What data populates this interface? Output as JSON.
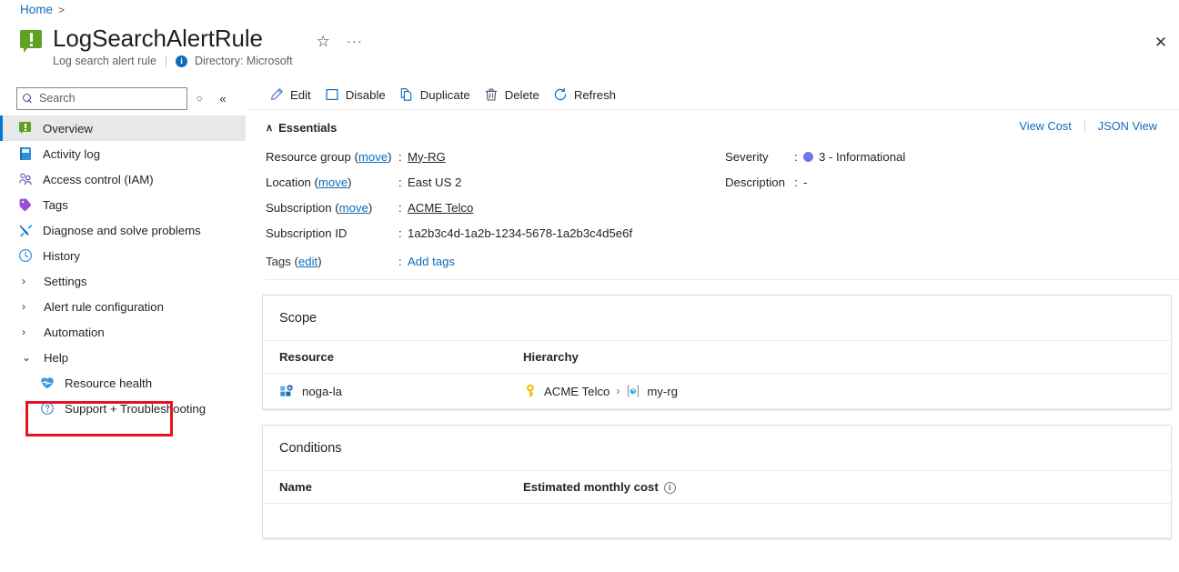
{
  "breadcrumb": {
    "home": "Home",
    "separator": ">"
  },
  "header": {
    "title": "LogSearchAlertRule",
    "subtitle": "Log search alert rule",
    "directory": "Directory: Microsoft",
    "info_badge": "i",
    "favorite_icon": "☆",
    "more_icon": "···",
    "close_icon": "✕"
  },
  "sidebar": {
    "search_placeholder": "Search",
    "search_value": "",
    "refresh_icon": "○",
    "collapse_icon": "«",
    "items": [
      {
        "label": "Overview",
        "icon": "alert-icon",
        "selected": true
      },
      {
        "label": "Activity log",
        "icon": "book-icon",
        "selected": false
      },
      {
        "label": "Access control (IAM)",
        "icon": "people-icon",
        "selected": false
      },
      {
        "label": "Tags",
        "icon": "tag-icon",
        "selected": false
      },
      {
        "label": "Diagnose and solve problems",
        "icon": "tools-icon",
        "selected": false
      },
      {
        "label": "History",
        "icon": "clock-icon",
        "selected": false
      }
    ],
    "groups": [
      {
        "label": "Settings",
        "expanded": false,
        "chevron": "›"
      },
      {
        "label": "Alert rule configuration",
        "expanded": false,
        "chevron": "›"
      },
      {
        "label": "Automation",
        "expanded": false,
        "chevron": "›"
      },
      {
        "label": "Help",
        "expanded": true,
        "chevron": "⌄"
      }
    ],
    "help_children": [
      {
        "label": "Resource health",
        "icon": "heart-pulse-icon",
        "highlighted": true
      },
      {
        "label": "Support + Troubleshooting",
        "icon": "question-circle-icon",
        "highlighted": false
      }
    ]
  },
  "toolbar": {
    "items": [
      {
        "label": "Edit",
        "icon": "pencil-icon"
      },
      {
        "label": "Disable",
        "icon": "square-icon"
      },
      {
        "label": "Duplicate",
        "icon": "copy-icon"
      },
      {
        "label": "Delete",
        "icon": "trash-icon"
      },
      {
        "label": "Refresh",
        "icon": "refresh-icon"
      }
    ]
  },
  "essentials": {
    "heading": "Essentials",
    "caret": "∧",
    "view_cost": "View Cost",
    "json_view": "JSON View",
    "left": [
      {
        "key": "Resource group",
        "key_link": "move",
        "sep": ":",
        "value": "My-RG",
        "value_is_link": true
      },
      {
        "key": "Location",
        "key_link": "move",
        "sep": ":",
        "value": "East US 2",
        "value_is_link": false
      },
      {
        "key": "Subscription",
        "key_link": "move",
        "sep": ":",
        "value": "ACME Telco",
        "value_is_link": true
      },
      {
        "key": "Subscription ID",
        "key_link": "",
        "sep": ":",
        "value": "1a2b3c4d-1a2b-1234-5678-1a2b3c4d5e6f",
        "value_is_link": false
      }
    ],
    "right": [
      {
        "key": "Severity",
        "sep": ":",
        "value": "3 - Informational",
        "dot_color": "#6e76e8"
      },
      {
        "key": "Description",
        "sep": ":",
        "value": "-",
        "dot_color": ""
      }
    ],
    "tags": {
      "key": "Tags",
      "key_link": "edit",
      "sep": ":",
      "value": "Add tags"
    }
  },
  "scope_card": {
    "title": "Scope",
    "columns": [
      "Resource",
      "Hierarchy"
    ],
    "rows": [
      {
        "resource": "noga-la",
        "resource_icon": "log-analytics-icon",
        "hierarchy_subscription": "ACME Telco",
        "hierarchy_separator": "›",
        "hierarchy_resource_group": "my-rg",
        "subscription_icon": "key-icon",
        "resource_group_icon": "resource-group-icon"
      }
    ]
  },
  "conditions_card": {
    "title": "Conditions",
    "columns": [
      "Name",
      "Estimated monthly cost"
    ],
    "info_icon": "i"
  },
  "colors": {
    "accent": "#0078d4",
    "link": "#0f6cbd",
    "highlight": "#e81123",
    "alert_green": "#5ea226",
    "severity": "#6e76e8"
  }
}
